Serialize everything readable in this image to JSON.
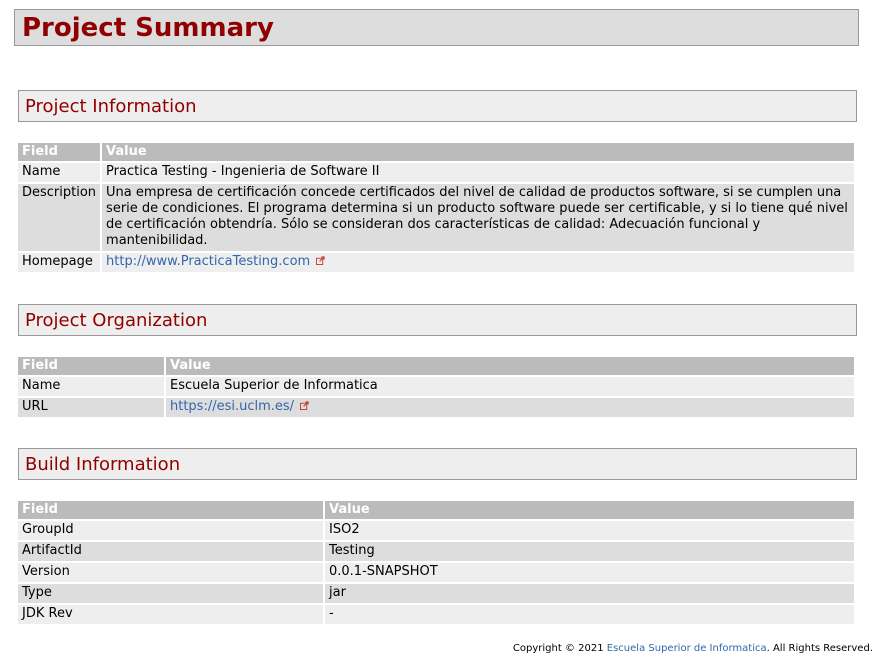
{
  "title": "Project Summary",
  "sections": [
    {
      "heading": "Project Information",
      "col_field": "Field",
      "col_value": "Value",
      "rows": [
        {
          "field": "Name",
          "value": "Practica Testing - Ingenieria de Software II"
        },
        {
          "field": "Description",
          "value": "Una empresa de certificación concede certificados del nivel de calidad de productos software, si se cumplen una serie de condiciones. El programa determina si un producto software puede ser certificable, y si lo tiene qué nivel de certificación obtendría. Sólo se consideran dos características de calidad: Adecuación funcional y mantenibilidad."
        },
        {
          "field": "Homepage",
          "value": "http://www.PracticaTesting.com"
        }
      ]
    },
    {
      "heading": "Project Organization",
      "col_field": "Field",
      "col_value": "Value",
      "rows": [
        {
          "field": "Name",
          "value": "Escuela Superior de Informatica"
        },
        {
          "field": "URL",
          "value": "https://esi.uclm.es/"
        }
      ]
    },
    {
      "heading": "Build Information",
      "col_field": "Field",
      "col_value": "Value",
      "rows": [
        {
          "field": "GroupId",
          "value": "ISO2"
        },
        {
          "field": "ArtifactId",
          "value": "Testing"
        },
        {
          "field": "Version",
          "value": "0.0.1-SNAPSHOT"
        },
        {
          "field": "Type",
          "value": "jar"
        },
        {
          "field": "JDK Rev",
          "value": "-"
        }
      ]
    }
  ],
  "footer": {
    "prefix": "Copyright © 2021 ",
    "link": "Escuela Superior de Informatica",
    "suffix": ". All Rights Reserved."
  },
  "icons": {
    "external_link": "external-link-icon"
  },
  "colors": {
    "heading": "#900000",
    "link": "#3366aa",
    "table_header": "#bbbbbb"
  }
}
